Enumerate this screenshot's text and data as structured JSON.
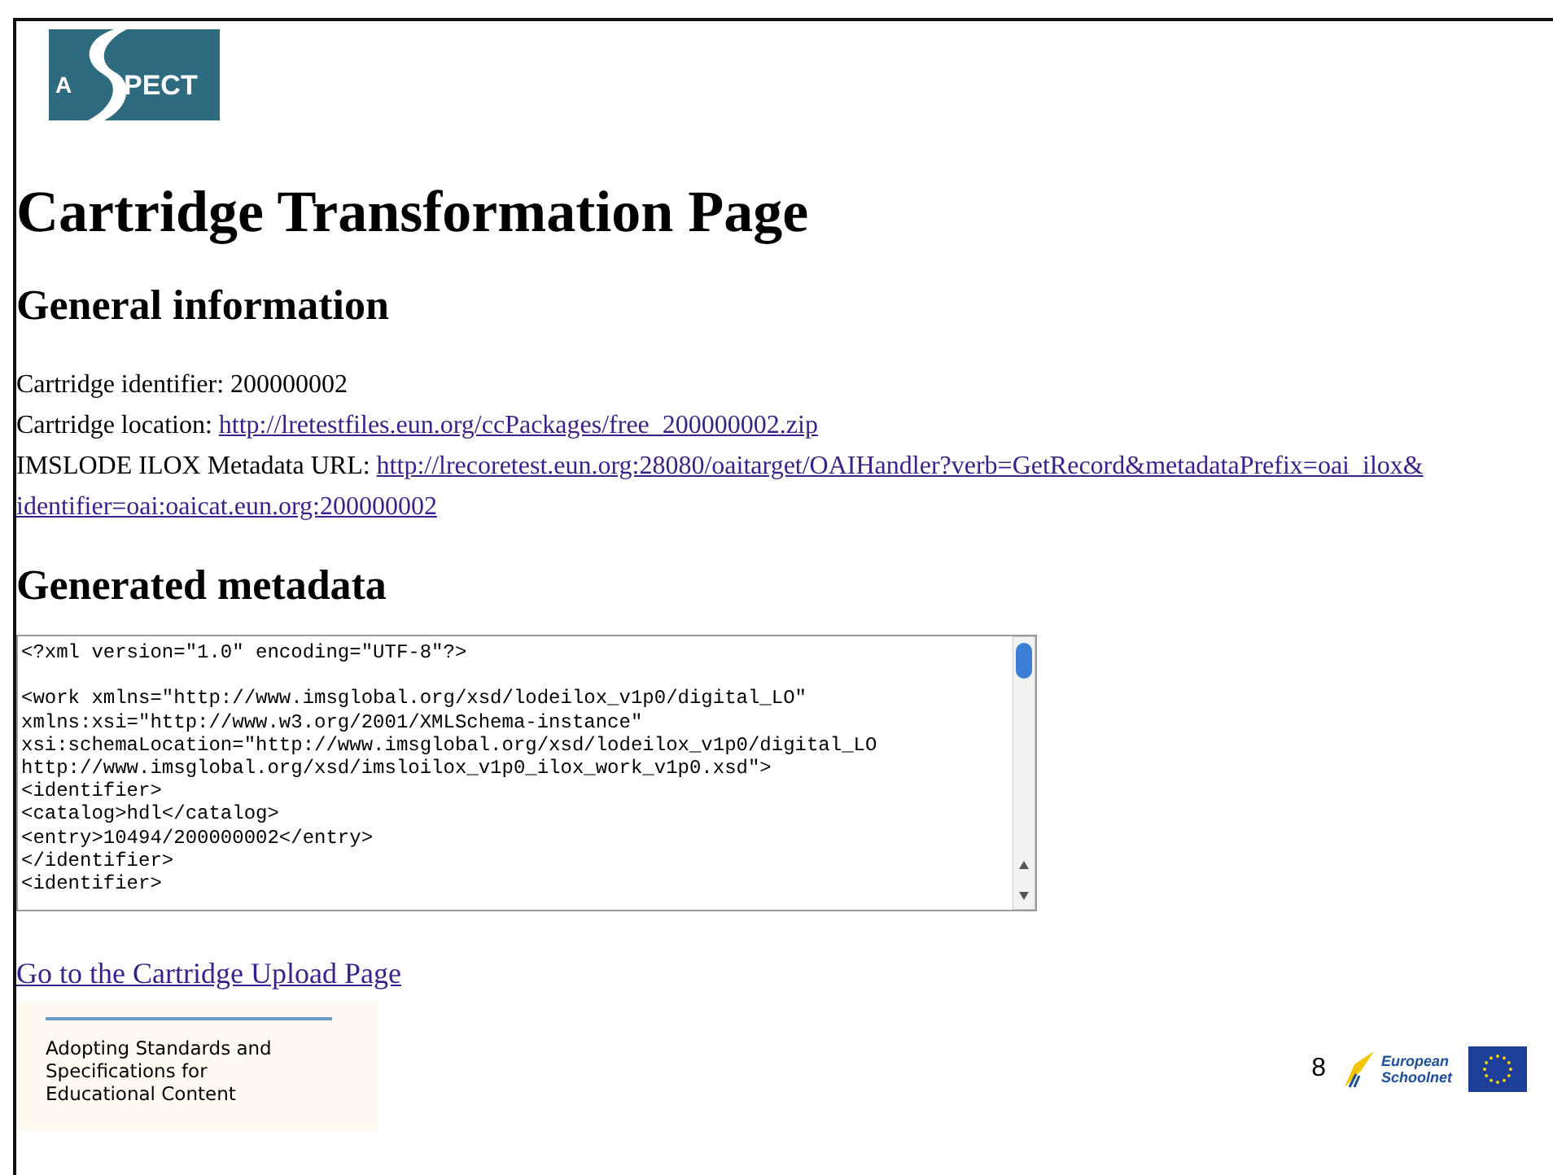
{
  "logo": {
    "left": "A",
    "right": "PECT"
  },
  "title": "Cartridge Transformation Page",
  "general": {
    "heading": "General information",
    "identifier": {
      "label": "Cartridge identifier:",
      "value": "200000002"
    },
    "location": {
      "label": "Cartridge location:",
      "url": "http://lretestfiles.eun.org/ccPackages/free_200000002.zip"
    },
    "metadata_url": {
      "label": "IMSLODE ILOX Metadata URL:",
      "url_lines": [
        "http://lrecoretest.eun.org:28080/oaitarget/OAIHandler?verb=GetRecord&metadataPrefix=oai_ilox&",
        "identifier=oai:oaicat.eun.org:200000002"
      ]
    }
  },
  "generated": {
    "heading": "Generated metadata",
    "paragraphs": [
      [
        "<?xml version=\"1.0\" encoding=\"UTF-8\"?>"
      ],
      [
        "<work xmlns=\"http://www.imsglobal.org/xsd/lodeilox_v1p0/digital_LO\"",
        "xmlns:xsi=\"http://www.w3.org/2001/XMLSchema-instance\"",
        "xsi:schemaLocation=\"http://www.imsglobal.org/xsd/lodeilox_v1p0/digital_LO",
        "http://www.imsglobal.org/xsd/imsloilox_v1p0_ilox_work_v1p0.xsd\">",
        "<identifier>",
        "<catalog>hdl</catalog>",
        "<entry>10494/200000002</entry>",
        "</identifier>",
        "<identifier>"
      ]
    ]
  },
  "upload_link": "Go to the Cartridge Upload Page",
  "footer": {
    "project": "Adopting Standards and Specifications for Educational Content",
    "page_number": "8",
    "partner": {
      "line1": "European",
      "line2": "Schoolnet"
    }
  }
}
